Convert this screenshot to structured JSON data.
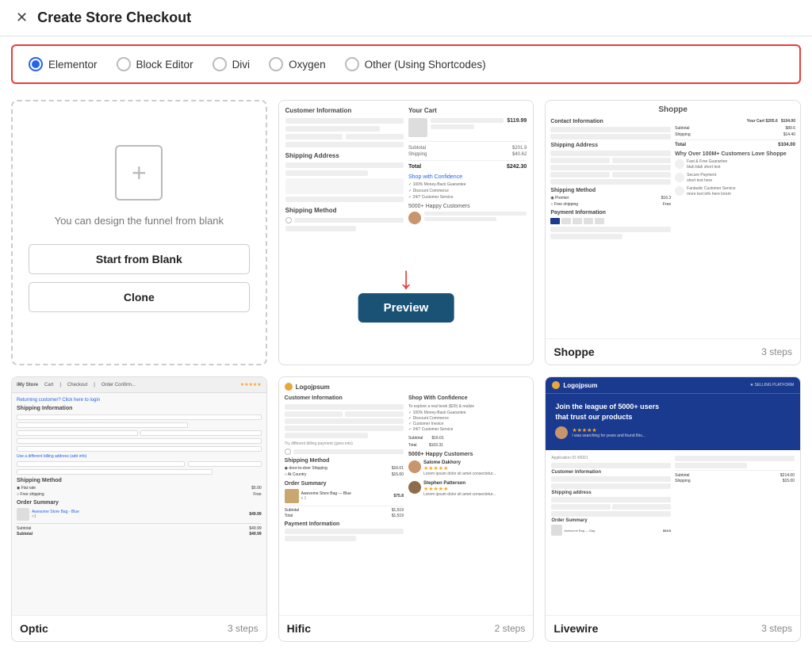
{
  "header": {
    "close_icon": "✕",
    "title": "Create Store Checkout"
  },
  "editor_selector": {
    "options": [
      {
        "id": "elementor",
        "label": "Elementor",
        "selected": true
      },
      {
        "id": "block-editor",
        "label": "Block Editor",
        "selected": false
      },
      {
        "id": "divi",
        "label": "Divi",
        "selected": false
      },
      {
        "id": "oxygen",
        "label": "Oxygen",
        "selected": false
      },
      {
        "id": "other",
        "label": "Other (Using Shortcodes)",
        "selected": false
      }
    ]
  },
  "blank_card": {
    "description": "You can design the funnel from blank",
    "start_label": "Start from Blank",
    "clone_label": "Clone"
  },
  "templates": [
    {
      "id": "checkout-default",
      "name": "",
      "steps": "",
      "has_preview": true,
      "preview_label": "Preview"
    },
    {
      "id": "shoppe",
      "name": "Shoppe",
      "steps": "3 steps"
    },
    {
      "id": "optic",
      "name": "Optic",
      "steps": "3 steps"
    },
    {
      "id": "hific",
      "name": "Hific",
      "steps": "2 steps"
    },
    {
      "id": "livewire",
      "name": "Livewire",
      "steps": "3 steps"
    }
  ]
}
